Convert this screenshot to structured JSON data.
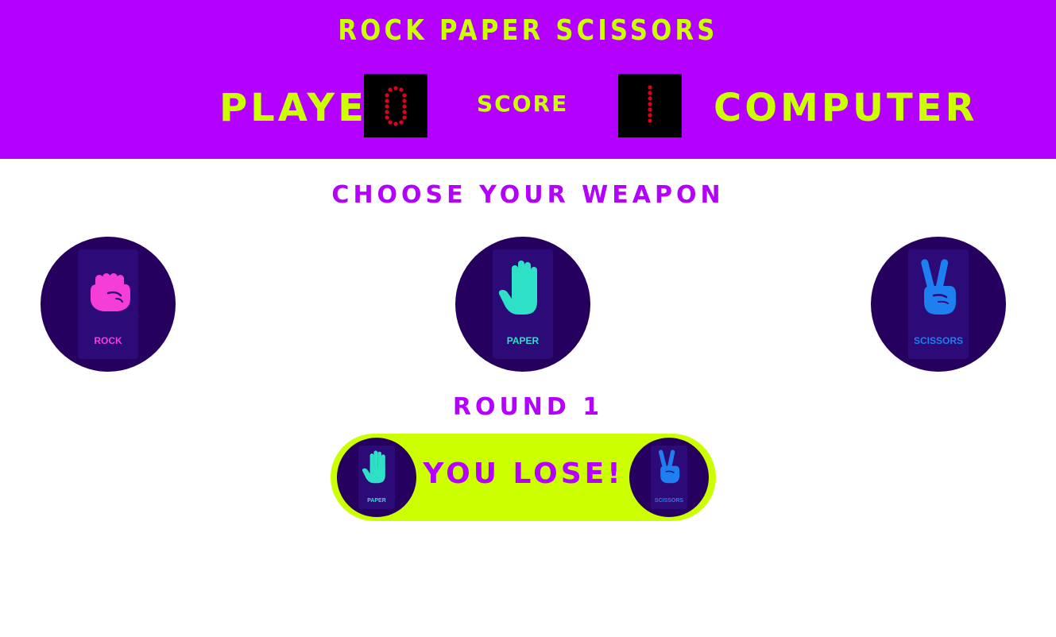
{
  "header": {
    "title": "ROCK PAPER SCISSORS",
    "player_label": "PLAYER",
    "score_label": "SCORE",
    "computer_label": "COMPUTER",
    "player_score": 0,
    "computer_score": 1
  },
  "prompt": "CHOOSE YOUR WEAPON",
  "weapons": [
    {
      "label": "ROCK",
      "icon": "fist-icon",
      "color": "#f53ed8"
    },
    {
      "label": "PAPER",
      "icon": "open-hand-icon",
      "color": "#2ee0c6"
    },
    {
      "label": "SCISSORS",
      "icon": "peace-hand-icon",
      "color": "#1d7ff0"
    }
  ],
  "round": "ROUND 1",
  "result": {
    "text": "YOU LOSE!",
    "player_choice": "PAPER",
    "computer_choice": "SCISSORS"
  },
  "colors": {
    "header_bg": "#b300ff",
    "accent": "#ccff00",
    "circle_bg": "#26005e",
    "score_led": "#e0001b"
  }
}
